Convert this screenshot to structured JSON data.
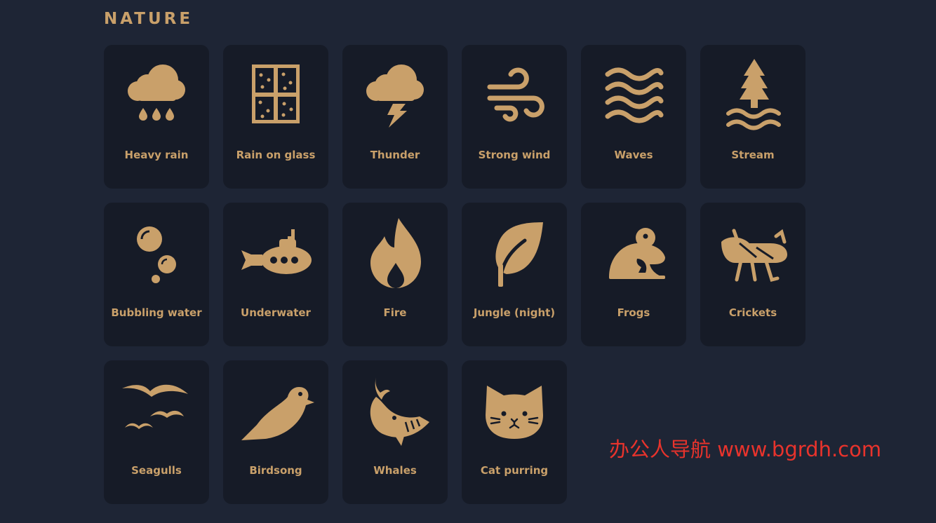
{
  "section": {
    "title": "NATURE"
  },
  "colors": {
    "background": "#1e2535",
    "tile": "#161b27",
    "accent": "#c9a06a",
    "watermark": "#e8332c"
  },
  "tiles": [
    {
      "label": "Heavy rain",
      "icon": "rain-cloud-icon"
    },
    {
      "label": "Rain on glass",
      "icon": "window-rain-icon"
    },
    {
      "label": "Thunder",
      "icon": "thunder-cloud-icon"
    },
    {
      "label": "Strong wind",
      "icon": "wind-icon"
    },
    {
      "label": "Waves",
      "icon": "waves-icon"
    },
    {
      "label": "Stream",
      "icon": "stream-tree-icon"
    },
    {
      "label": "Bubbling water",
      "icon": "bubbles-icon"
    },
    {
      "label": "Underwater",
      "icon": "submarine-icon"
    },
    {
      "label": "Fire",
      "icon": "fire-icon"
    },
    {
      "label": "Jungle (night)",
      "icon": "leaf-icon"
    },
    {
      "label": "Frogs",
      "icon": "frog-icon"
    },
    {
      "label": "Crickets",
      "icon": "cricket-icon"
    },
    {
      "label": "Seagulls",
      "icon": "seagulls-icon"
    },
    {
      "label": "Birdsong",
      "icon": "bird-icon"
    },
    {
      "label": "Whales",
      "icon": "whale-icon"
    },
    {
      "label": "Cat purring",
      "icon": "cat-icon"
    }
  ],
  "watermark": {
    "text": "办公人导航 www.bgrdh.com"
  }
}
